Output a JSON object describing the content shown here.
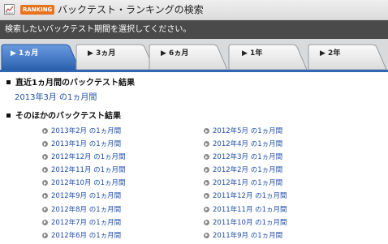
{
  "header": {
    "badge": "RANKING",
    "title": "バックテスト・ランキングの検索"
  },
  "subbar": {
    "text": "検索したいバックテスト期間を選択してください。"
  },
  "tabs": [
    {
      "label": "▶ 1ヵ月",
      "active": true
    },
    {
      "label": "▶ 3ヵ月",
      "active": false
    },
    {
      "label": "▶ 6ヵ月",
      "active": false
    },
    {
      "label": "▶ 1年",
      "active": false
    },
    {
      "label": "▶ 2年",
      "active": false
    }
  ],
  "recent": {
    "heading": "直近1ヵ月間のバックテスト結果",
    "link": "2013年3月 の1ヵ月間"
  },
  "others": {
    "heading": "そのほかのバックテスト結果",
    "left": [
      "2013年2月 の1ヵ月間",
      "2013年1月 の1ヵ月間",
      "2012年12月 の1ヵ月間",
      "2012年11月 の1ヵ月間",
      "2012年10月 の1ヵ月間",
      "2012年9月 の1ヵ月間",
      "2012年8月 の1ヵ月間",
      "2012年7月 の1ヵ月間",
      "2012年6月 の1ヵ月間"
    ],
    "right": [
      "2012年5月 の1ヵ月間",
      "2012年4月 の1ヵ月間",
      "2012年3月 の1ヵ月間",
      "2012年2月 の1ヵ月間",
      "2012年1月 の1ヵ月間",
      "2011年12月 の1ヵ月間",
      "2011年11月 の1ヵ月間",
      "2011年10月 の1ヵ月間",
      "2011年9月 の1ヵ月間"
    ]
  },
  "colors": {
    "tab_active": "#3a74c4",
    "tab_inactive": "#eeeeee",
    "link": "#1f4fa8",
    "badge": "#e8731d"
  }
}
